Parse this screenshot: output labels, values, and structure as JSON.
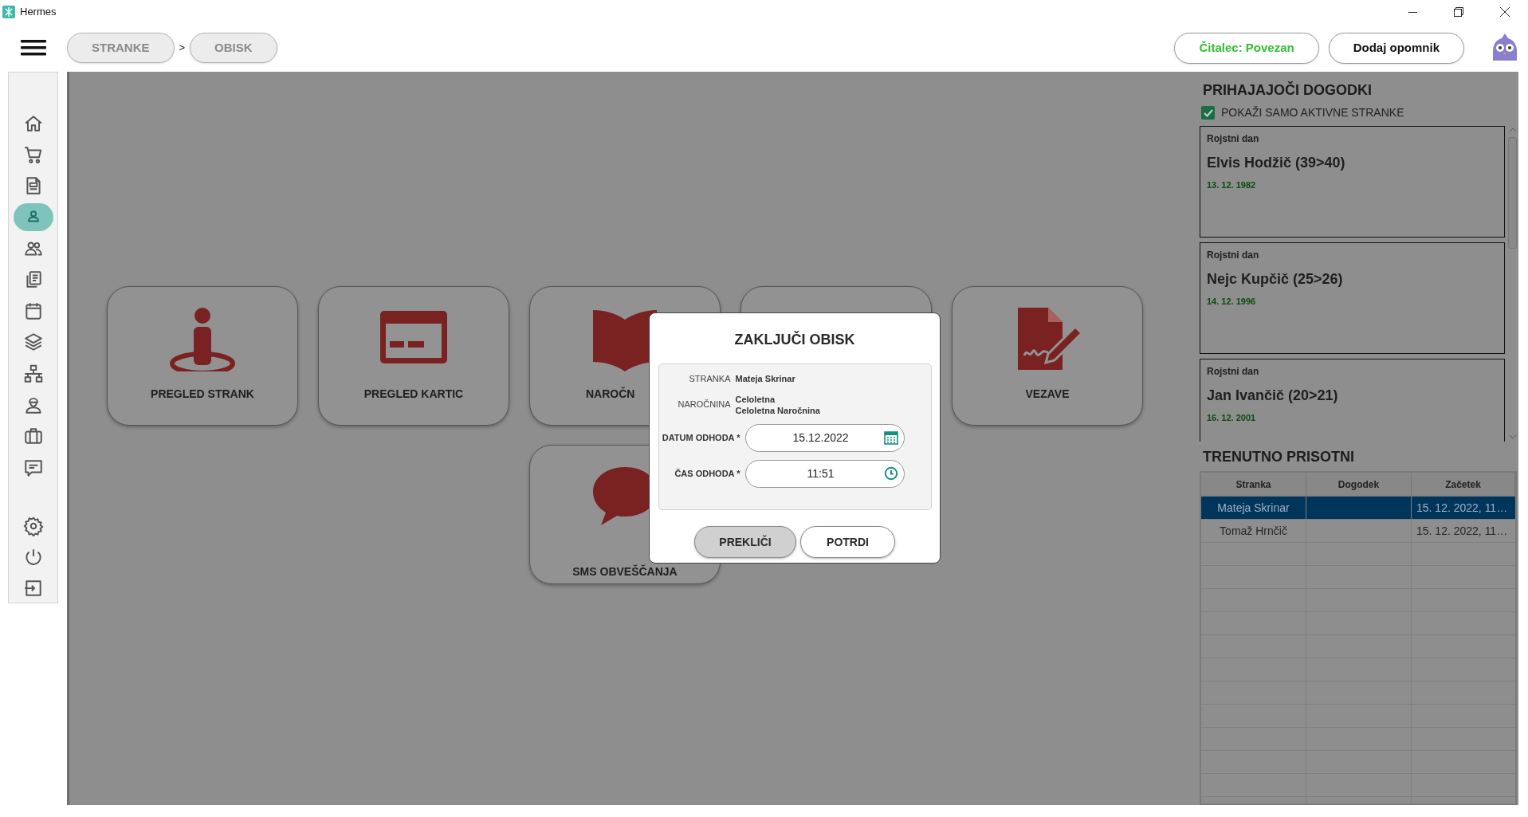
{
  "window": {
    "title": "Hermes"
  },
  "toolbar": {
    "breadcrumbs": [
      {
        "label": "STRANKE"
      },
      {
        "label": "OBISK"
      }
    ],
    "separator": ">",
    "reader_status": "Čitalec: Povezan",
    "reminder_button": "Dodaj opomnik"
  },
  "sidebar": {
    "items": [
      {
        "kind": "home",
        "selected": false
      },
      {
        "kind": "cart",
        "selected": false
      },
      {
        "kind": "document",
        "selected": false
      },
      {
        "kind": "user",
        "selected": true
      },
      {
        "kind": "users",
        "selected": false
      },
      {
        "kind": "copies",
        "selected": false
      },
      {
        "kind": "calendar",
        "selected": false
      },
      {
        "kind": "layers",
        "selected": false
      },
      {
        "kind": "network",
        "selected": false
      },
      {
        "kind": "worker",
        "selected": false
      },
      {
        "kind": "briefcase",
        "selected": false
      },
      {
        "kind": "message",
        "selected": false
      },
      {
        "kind": "gear",
        "selected": false
      },
      {
        "kind": "power",
        "selected": false
      },
      {
        "kind": "exit",
        "selected": false
      }
    ]
  },
  "tiles": [
    {
      "kind": "person",
      "label": "PREGLED STRANK"
    },
    {
      "kind": "card",
      "label": "PREGLED KARTIC"
    },
    {
      "kind": "book",
      "label": "NAROČN",
      "covered": true
    },
    {
      "kind": "hidden"
    },
    {
      "kind": "signature",
      "label": "VEZAVE"
    },
    {
      "kind": "chat",
      "label": "SMS OBVEŠČANJA"
    }
  ],
  "modal": {
    "title": "ZAKLJUČI OBISK",
    "info": [
      {
        "label": "STRANKA",
        "lines": [
          "Mateja Skrinar"
        ]
      },
      {
        "label": "NAROČNINA",
        "lines": [
          "Celoletna",
          "Celoletna Naročnina"
        ]
      }
    ],
    "fields": [
      {
        "kind": "date",
        "label": "DATUM ODHODA *",
        "value": "15.12.2022"
      },
      {
        "kind": "time",
        "label": "ČAS ODHODA *",
        "value": "11:51"
      }
    ],
    "buttons": [
      {
        "label": "PREKLIČI",
        "kind": "secondary"
      },
      {
        "label": "POTRDI",
        "kind": "primary"
      }
    ]
  },
  "upcoming_events": {
    "title": "PRIHAJAJOČI DOGODKI",
    "filter": {
      "label": "POKAŽI SAMO AKTIVNE STRANKE",
      "checked": true
    },
    "events": [
      {
        "type": "Rojstni dan",
        "name": "Elvis Hodžič (39>40)",
        "date": "13. 12. 1982"
      },
      {
        "type": "Rojstni dan",
        "name": "Nejc Kupčič (25>26)",
        "date": "14. 12. 1996"
      },
      {
        "type": "Rojstni dan",
        "name": "Jan Ivančič (20>21)",
        "date": "16. 12. 2001"
      }
    ]
  },
  "present": {
    "title": "TRENUTNO PRISOTNI",
    "columns": [
      "Stranka",
      "Dogodek",
      "Začetek"
    ],
    "rows": [
      {
        "stranka": "Mateja Skrinar",
        "zacetek": "15. 12. 2022, 11…",
        "selected": true
      },
      {
        "stranka": "Tomaž Hrnčič",
        "zacetek": "15. 12. 2022, 11…",
        "selected": false
      }
    ]
  }
}
